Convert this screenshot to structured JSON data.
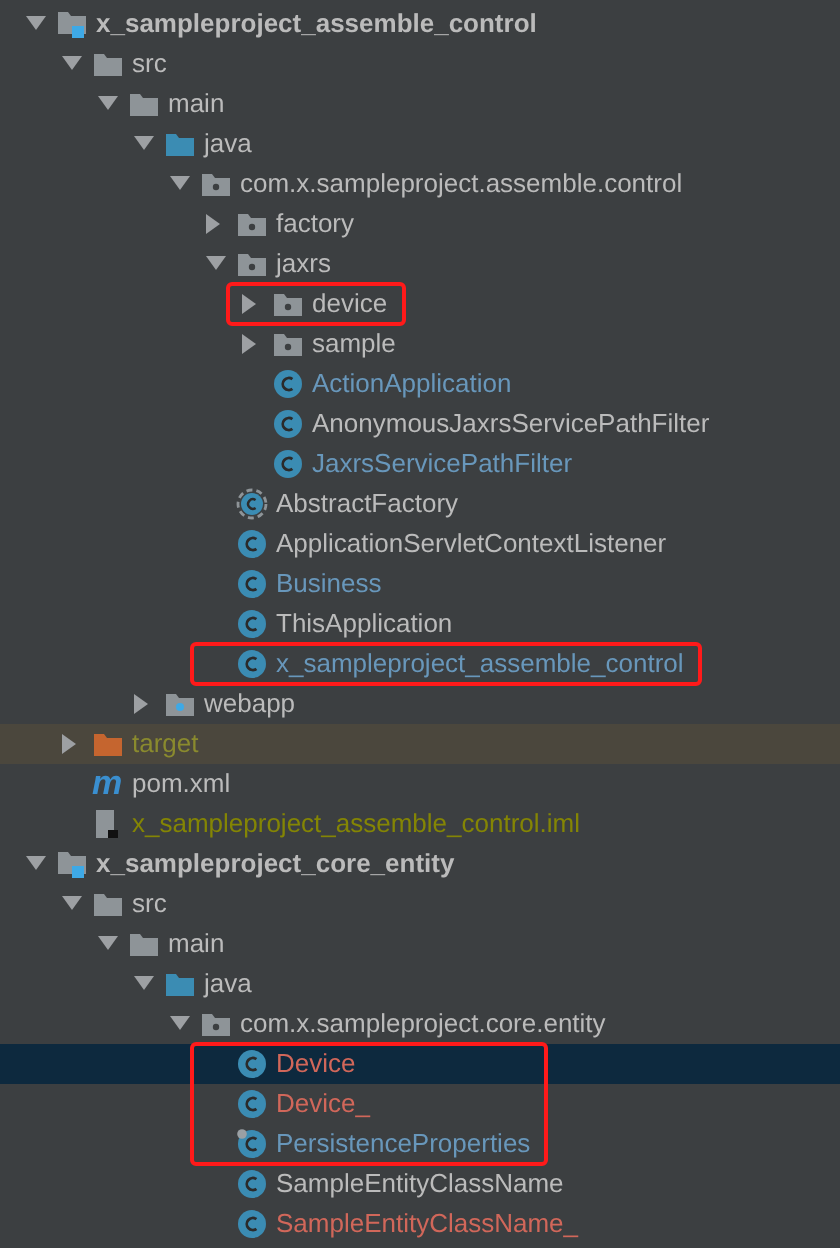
{
  "project_tree": [
    {
      "name": "x_sampleproject_assemble_control",
      "kind": "module",
      "color": "#bbbbbb",
      "expanded": true,
      "selected": false,
      "children": [
        {
          "name": "src",
          "kind": "folder",
          "color": "#bbbbbb",
          "expanded": true,
          "selected": false,
          "children": [
            {
              "name": "main",
              "kind": "folder",
              "color": "#bbbbbb",
              "expanded": true,
              "selected": false,
              "children": [
                {
                  "name": "java",
                  "kind": "source-root",
                  "color": "#bbbbbb",
                  "expanded": true,
                  "selected": false,
                  "children": [
                    {
                      "name": "com.x.sampleproject.assemble.control",
                      "kind": "package",
                      "color": "#bbbbbb",
                      "expanded": true,
                      "selected": false,
                      "children": [
                        {
                          "name": "factory",
                          "kind": "package",
                          "color": "#bbbbbb",
                          "expanded": false,
                          "selected": false
                        },
                        {
                          "name": "jaxrs",
                          "kind": "package",
                          "color": "#bbbbbb",
                          "expanded": true,
                          "selected": false,
                          "children": [
                            {
                              "name": "device",
                              "kind": "package",
                              "color": "#bbbbbb",
                              "expanded": false,
                              "selected": false,
                              "boxed": true
                            },
                            {
                              "name": "sample",
                              "kind": "package",
                              "color": "#bbbbbb",
                              "expanded": false,
                              "selected": false
                            },
                            {
                              "name": "ActionApplication",
                              "kind": "class",
                              "color": "#6897bb",
                              "selected": false
                            },
                            {
                              "name": "AnonymousJaxrsServicePathFilter",
                              "kind": "class",
                              "color": "#bbbbbb",
                              "selected": false
                            },
                            {
                              "name": "JaxrsServicePathFilter",
                              "kind": "class",
                              "color": "#6897bb",
                              "selected": false
                            }
                          ]
                        },
                        {
                          "name": "AbstractFactory",
                          "kind": "abstract-class",
                          "color": "#bbbbbb",
                          "selected": false
                        },
                        {
                          "name": "ApplicationServletContextListener",
                          "kind": "class",
                          "color": "#bbbbbb",
                          "selected": false
                        },
                        {
                          "name": "Business",
                          "kind": "class",
                          "color": "#6897bb",
                          "selected": false
                        },
                        {
                          "name": "ThisApplication",
                          "kind": "class",
                          "color": "#bbbbbb",
                          "selected": false
                        },
                        {
                          "name": "x_sampleproject_assemble_control",
                          "kind": "class",
                          "color": "#6897bb",
                          "selected": false,
                          "boxed": true
                        }
                      ]
                    }
                  ]
                },
                {
                  "name": "webapp",
                  "kind": "web-folder",
                  "color": "#bbbbbb",
                  "expanded": false,
                  "selected": false
                }
              ]
            }
          ]
        },
        {
          "name": "target",
          "kind": "excluded-folder",
          "color": "#8a8a2e",
          "excluded": true,
          "expanded": false,
          "selected": false
        },
        {
          "name": "pom.xml",
          "kind": "maven",
          "icon_text": "m",
          "color": "#bbbbbb",
          "selected": false
        },
        {
          "name": "x_sampleproject_assemble_control.iml",
          "kind": "iml",
          "color": "#848504",
          "selected": false
        }
      ]
    },
    {
      "name": "x_sampleproject_core_entity",
      "kind": "module",
      "color": "#bbbbbb",
      "expanded": true,
      "selected": false,
      "children": [
        {
          "name": "src",
          "kind": "folder",
          "color": "#bbbbbb",
          "expanded": true,
          "selected": false,
          "children": [
            {
              "name": "main",
              "kind": "folder",
              "color": "#bbbbbb",
              "expanded": true,
              "selected": false,
              "children": [
                {
                  "name": "java",
                  "kind": "source-root",
                  "color": "#bbbbbb",
                  "expanded": true,
                  "selected": false,
                  "children": [
                    {
                      "name": "com.x.sampleproject.core.entity",
                      "kind": "package",
                      "color": "#bbbbbb",
                      "expanded": true,
                      "selected": false,
                      "children": [
                        {
                          "name": "Device",
                          "kind": "class",
                          "color": "#d1675a",
                          "selected": true,
                          "boxed": true
                        },
                        {
                          "name": "Device_",
                          "kind": "class",
                          "color": "#d1675a",
                          "selected": false,
                          "boxed": true
                        },
                        {
                          "name": "PersistenceProperties",
                          "kind": "pinned-class",
                          "color": "#6897bb",
                          "selected": false,
                          "boxed": true
                        },
                        {
                          "name": "SampleEntityClassName",
                          "kind": "class",
                          "color": "#bbbbbb",
                          "selected": false
                        },
                        {
                          "name": "SampleEntityClassName_",
                          "kind": "class",
                          "color": "#d1675a",
                          "selected": false
                        }
                      ]
                    }
                  ]
                }
              ]
            }
          ]
        }
      ]
    }
  ]
}
